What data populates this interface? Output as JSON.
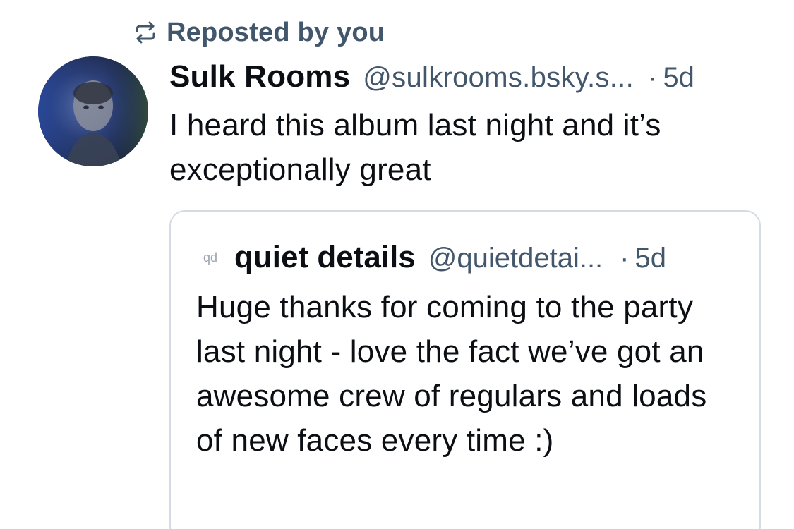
{
  "repost": {
    "icon": "repost-icon",
    "label": "Reposted by you"
  },
  "post": {
    "author_name": "Sulk Rooms",
    "author_handle": "@sulkrooms.bsky.s...",
    "separator": "·",
    "time": "5d",
    "text": "I heard this album last night and it’s exceptionally great"
  },
  "quote": {
    "avatar_initials": "qd",
    "author_name": "quiet details",
    "author_handle": "@quietdetai...",
    "separator": "·",
    "time": "5d",
    "text": "Huge thanks for coming to the party last night - love the fact we’ve got an awesome crew of regulars and loads of new faces every time :)"
  },
  "colors": {
    "text_primary": "#0b0f14",
    "text_secondary": "#42576c",
    "card_border": "#d4dbe2"
  }
}
